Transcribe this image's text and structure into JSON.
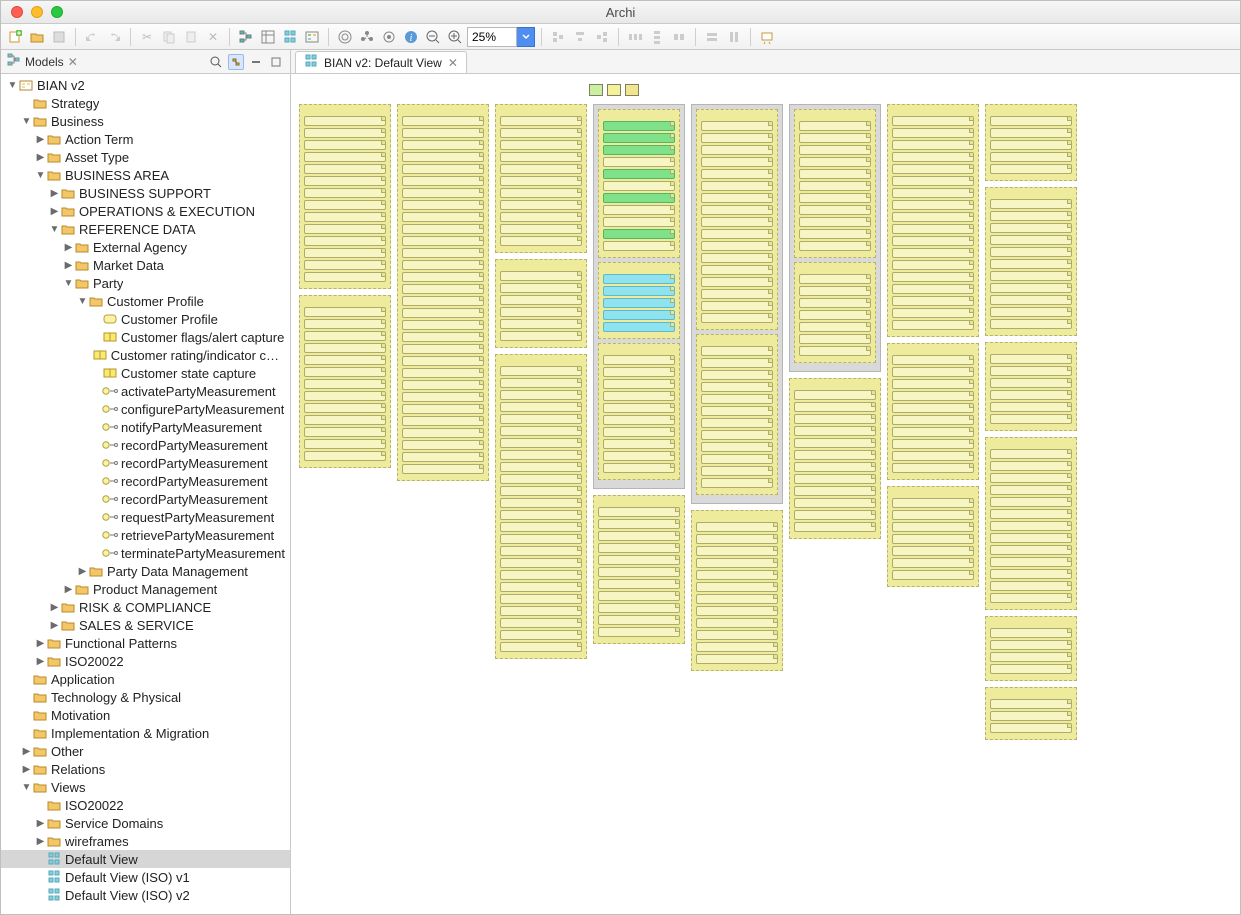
{
  "window": {
    "title": "Archi"
  },
  "panel": {
    "models_label": "Models",
    "search_placeholder": ""
  },
  "zoom": {
    "value": "25%"
  },
  "editor_tab": {
    "icon": "diagram-icon",
    "label": "BIAN v2: Default View"
  },
  "tree": [
    {
      "d": 0,
      "tw": "▼",
      "ic": "model",
      "t": "BIAN v2"
    },
    {
      "d": 1,
      "tw": "",
      "ic": "folder",
      "t": "Strategy"
    },
    {
      "d": 1,
      "tw": "▼",
      "ic": "folder",
      "t": "Business"
    },
    {
      "d": 2,
      "tw": "▶",
      "ic": "folder",
      "t": "Action Term"
    },
    {
      "d": 2,
      "tw": "▶",
      "ic": "folder",
      "t": "Asset Type"
    },
    {
      "d": 2,
      "tw": "▼",
      "ic": "folder",
      "t": "BUSINESS AREA"
    },
    {
      "d": 3,
      "tw": "▶",
      "ic": "folder",
      "t": "BUSINESS SUPPORT"
    },
    {
      "d": 3,
      "tw": "▶",
      "ic": "folder",
      "t": "OPERATIONS & EXECUTION"
    },
    {
      "d": 3,
      "tw": "▼",
      "ic": "folder",
      "t": "REFERENCE DATA"
    },
    {
      "d": 4,
      "tw": "▶",
      "ic": "folder",
      "t": "External Agency"
    },
    {
      "d": 4,
      "tw": "▶",
      "ic": "folder",
      "t": "Market Data"
    },
    {
      "d": 4,
      "tw": "▼",
      "ic": "folder",
      "t": "Party"
    },
    {
      "d": 5,
      "tw": "▼",
      "ic": "folder",
      "t": "Customer Profile"
    },
    {
      "d": 6,
      "tw": "",
      "ic": "obj",
      "t": "Customer Profile"
    },
    {
      "d": 6,
      "tw": "",
      "ic": "obj-y",
      "t": "Customer flags/alert capture"
    },
    {
      "d": 6,
      "tw": "",
      "ic": "obj-y",
      "t": "Customer rating/indicator capture"
    },
    {
      "d": 6,
      "tw": "",
      "ic": "obj-y",
      "t": "Customer state capture"
    },
    {
      "d": 6,
      "tw": "",
      "ic": "evt",
      "t": "activatePartyMeasurement"
    },
    {
      "d": 6,
      "tw": "",
      "ic": "evt",
      "t": "configurePartyMeasurement"
    },
    {
      "d": 6,
      "tw": "",
      "ic": "evt",
      "t": "notifyPartyMeasurement"
    },
    {
      "d": 6,
      "tw": "",
      "ic": "evt",
      "t": "recordPartyMeasurement"
    },
    {
      "d": 6,
      "tw": "",
      "ic": "evt",
      "t": "recordPartyMeasurement"
    },
    {
      "d": 6,
      "tw": "",
      "ic": "evt",
      "t": "recordPartyMeasurement"
    },
    {
      "d": 6,
      "tw": "",
      "ic": "evt",
      "t": "recordPartyMeasurement"
    },
    {
      "d": 6,
      "tw": "",
      "ic": "evt",
      "t": "requestPartyMeasurement"
    },
    {
      "d": 6,
      "tw": "",
      "ic": "evt",
      "t": "retrievePartyMeasurement"
    },
    {
      "d": 6,
      "tw": "",
      "ic": "evt",
      "t": "terminatePartyMeasurement"
    },
    {
      "d": 5,
      "tw": "▶",
      "ic": "folder",
      "t": "Party Data Management"
    },
    {
      "d": 4,
      "tw": "▶",
      "ic": "folder",
      "t": "Product Management"
    },
    {
      "d": 3,
      "tw": "▶",
      "ic": "folder",
      "t": "RISK & COMPLIANCE"
    },
    {
      "d": 3,
      "tw": "▶",
      "ic": "folder",
      "t": "SALES & SERVICE"
    },
    {
      "d": 2,
      "tw": "▶",
      "ic": "folder",
      "t": "Functional Patterns"
    },
    {
      "d": 2,
      "tw": "▶",
      "ic": "folder",
      "t": "ISO20022"
    },
    {
      "d": 1,
      "tw": "",
      "ic": "folder",
      "t": "Application"
    },
    {
      "d": 1,
      "tw": "",
      "ic": "folder",
      "t": "Technology & Physical"
    },
    {
      "d": 1,
      "tw": "",
      "ic": "folder",
      "t": "Motivation"
    },
    {
      "d": 1,
      "tw": "",
      "ic": "folder",
      "t": "Implementation & Migration"
    },
    {
      "d": 1,
      "tw": "▶",
      "ic": "folder",
      "t": "Other"
    },
    {
      "d": 1,
      "tw": "▶",
      "ic": "folder",
      "t": "Relations"
    },
    {
      "d": 1,
      "tw": "▼",
      "ic": "folder",
      "t": "Views"
    },
    {
      "d": 2,
      "tw": "",
      "ic": "folder",
      "t": "ISO20022"
    },
    {
      "d": 2,
      "tw": "▶",
      "ic": "folder",
      "t": "Service Domains"
    },
    {
      "d": 2,
      "tw": "▶",
      "ic": "folder",
      "t": "wireframes"
    },
    {
      "d": 2,
      "tw": "",
      "ic": "view",
      "t": "Default View",
      "sel": true
    },
    {
      "d": 2,
      "tw": "",
      "ic": "view",
      "t": "Default View (ISO) v1"
    },
    {
      "d": 2,
      "tw": "",
      "ic": "view",
      "t": "Default View (ISO) v2"
    }
  ],
  "legend": [
    "",
    "",
    ""
  ],
  "canvas_layout": {
    "columns": [
      {
        "blocks": [
          {
            "n": 14
          },
          {
            "n": 13
          }
        ]
      },
      {
        "blocks": [
          {
            "n": 30
          }
        ]
      },
      {
        "blocks": [
          {
            "n": 11
          },
          {
            "n": 6
          },
          {
            "n": 24
          }
        ]
      },
      {
        "blocks": [
          {
            "grey": true,
            "sub": [
              {
                "n": 11,
                "mix": [
                  "g",
                  "g",
                  "g",
                  "",
                  "g",
                  "",
                  "g",
                  "",
                  "",
                  "g",
                  ""
                ]
              },
              {
                "n": 5,
                "mix": [
                  "b",
                  "b",
                  "b",
                  "b",
                  "b"
                ]
              },
              {
                "n": 10
              }
            ]
          },
          {
            "n": 11
          }
        ]
      },
      {
        "blocks": [
          {
            "grey": true,
            "sub": [
              {
                "n": 17
              },
              {
                "n": 12
              }
            ]
          },
          {
            "n": 12
          }
        ]
      },
      {
        "blocks": [
          {
            "grey": true,
            "sub": [
              {
                "n": 11
              },
              {
                "n": 7
              }
            ]
          },
          {
            "n": 12
          }
        ]
      },
      {
        "blocks": [
          {
            "n": 18
          },
          {
            "n": 10
          },
          {
            "n": 7
          }
        ]
      },
      {
        "blocks": [
          {
            "n": 5
          },
          {
            "n": 11
          },
          {
            "n": 6
          },
          {
            "n": 13
          },
          {
            "n": 4
          },
          {
            "n": 3
          }
        ]
      }
    ]
  }
}
